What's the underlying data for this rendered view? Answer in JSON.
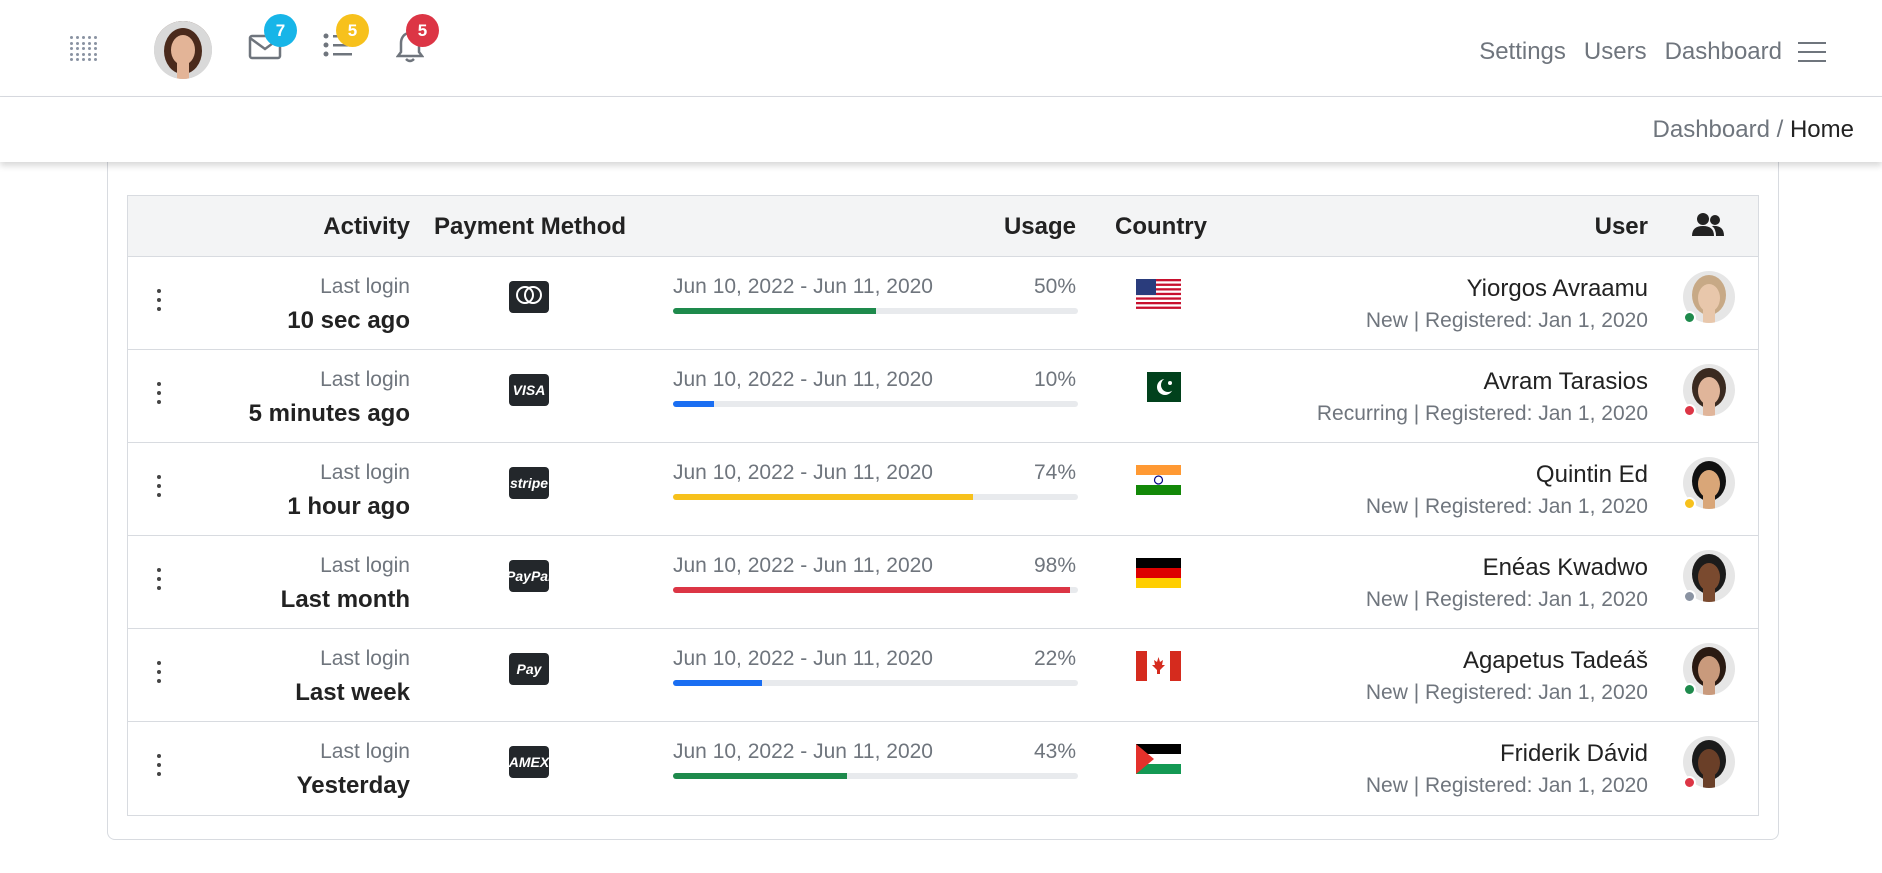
{
  "header": {
    "nav_links": [
      "Settings",
      "Users",
      "Dashboard"
    ],
    "badges": {
      "mail": "7",
      "tasks": "5",
      "notifications": "5"
    }
  },
  "breadcrumb": {
    "parent": "Dashboard",
    "separator": "/",
    "current": "Home"
  },
  "table": {
    "headers": {
      "activity": "Activity",
      "payment": "Payment Method",
      "usage": "Usage",
      "country": "Country",
      "user": "User"
    },
    "rows": [
      {
        "activity_label": "Last login",
        "activity_time": "10 sec ago",
        "payment": "mastercard",
        "usage_dates": "Jun 10, 2022 - Jun 11, 2020",
        "usage_pct": "50%",
        "usage_value": 0.5,
        "usage_color": "#1e8a4c",
        "country": "US",
        "user_name": "Yiorgos Avraamu",
        "user_meta": "New | Registered: Jan 1, 2020",
        "status_color": "#1e8a4c"
      },
      {
        "activity_label": "Last login",
        "activity_time": "5 minutes ago",
        "payment": "VISA",
        "usage_dates": "Jun 10, 2022 - Jun 11, 2020",
        "usage_pct": "10%",
        "usage_value": 0.1,
        "usage_color": "#1a6ef2",
        "country": "PK",
        "user_name": "Avram Tarasios",
        "user_meta": "Recurring | Registered: Jan 1, 2020",
        "status_color": "#dc3545"
      },
      {
        "activity_label": "Last login",
        "activity_time": "1 hour ago",
        "payment": "stripe",
        "usage_dates": "Jun 10, 2022 - Jun 11, 2020",
        "usage_pct": "74%",
        "usage_value": 0.74,
        "usage_color": "#f7c11c",
        "country": "IN",
        "user_name": "Quintin Ed",
        "user_meta": "New | Registered: Jan 1, 2020",
        "status_color": "#f7c11c"
      },
      {
        "activity_label": "Last login",
        "activity_time": "Last month",
        "payment": "PayPal",
        "usage_dates": "Jun 10, 2022 - Jun 11, 2020",
        "usage_pct": "98%",
        "usage_value": 0.98,
        "usage_color": "#dc3545",
        "country": "DE",
        "user_name": "Enéas Kwadwo",
        "user_meta": "New | Registered: Jan 1, 2020",
        "status_color": "#8a93a2"
      },
      {
        "activity_label": "Last login",
        "activity_time": "Last week",
        "payment": "Pay",
        "usage_dates": "Jun 10, 2022 - Jun 11, 2020",
        "usage_pct": "22%",
        "usage_value": 0.22,
        "usage_color": "#1a6ef2",
        "country": "CA",
        "user_name": "Agapetus Tadeáš",
        "user_meta": "New | Registered: Jan 1, 2020",
        "status_color": "#1e8a4c"
      },
      {
        "activity_label": "Last login",
        "activity_time": "Yesterday",
        "payment": "AMEX",
        "usage_dates": "Jun 10, 2022 - Jun 11, 2020",
        "usage_pct": "43%",
        "usage_value": 0.43,
        "usage_color": "#1e8a4c",
        "country": "PS",
        "user_name": "Friderik Dávid",
        "user_meta": "New | Registered: Jan 1, 2020",
        "status_color": "#dc3545"
      }
    ]
  }
}
